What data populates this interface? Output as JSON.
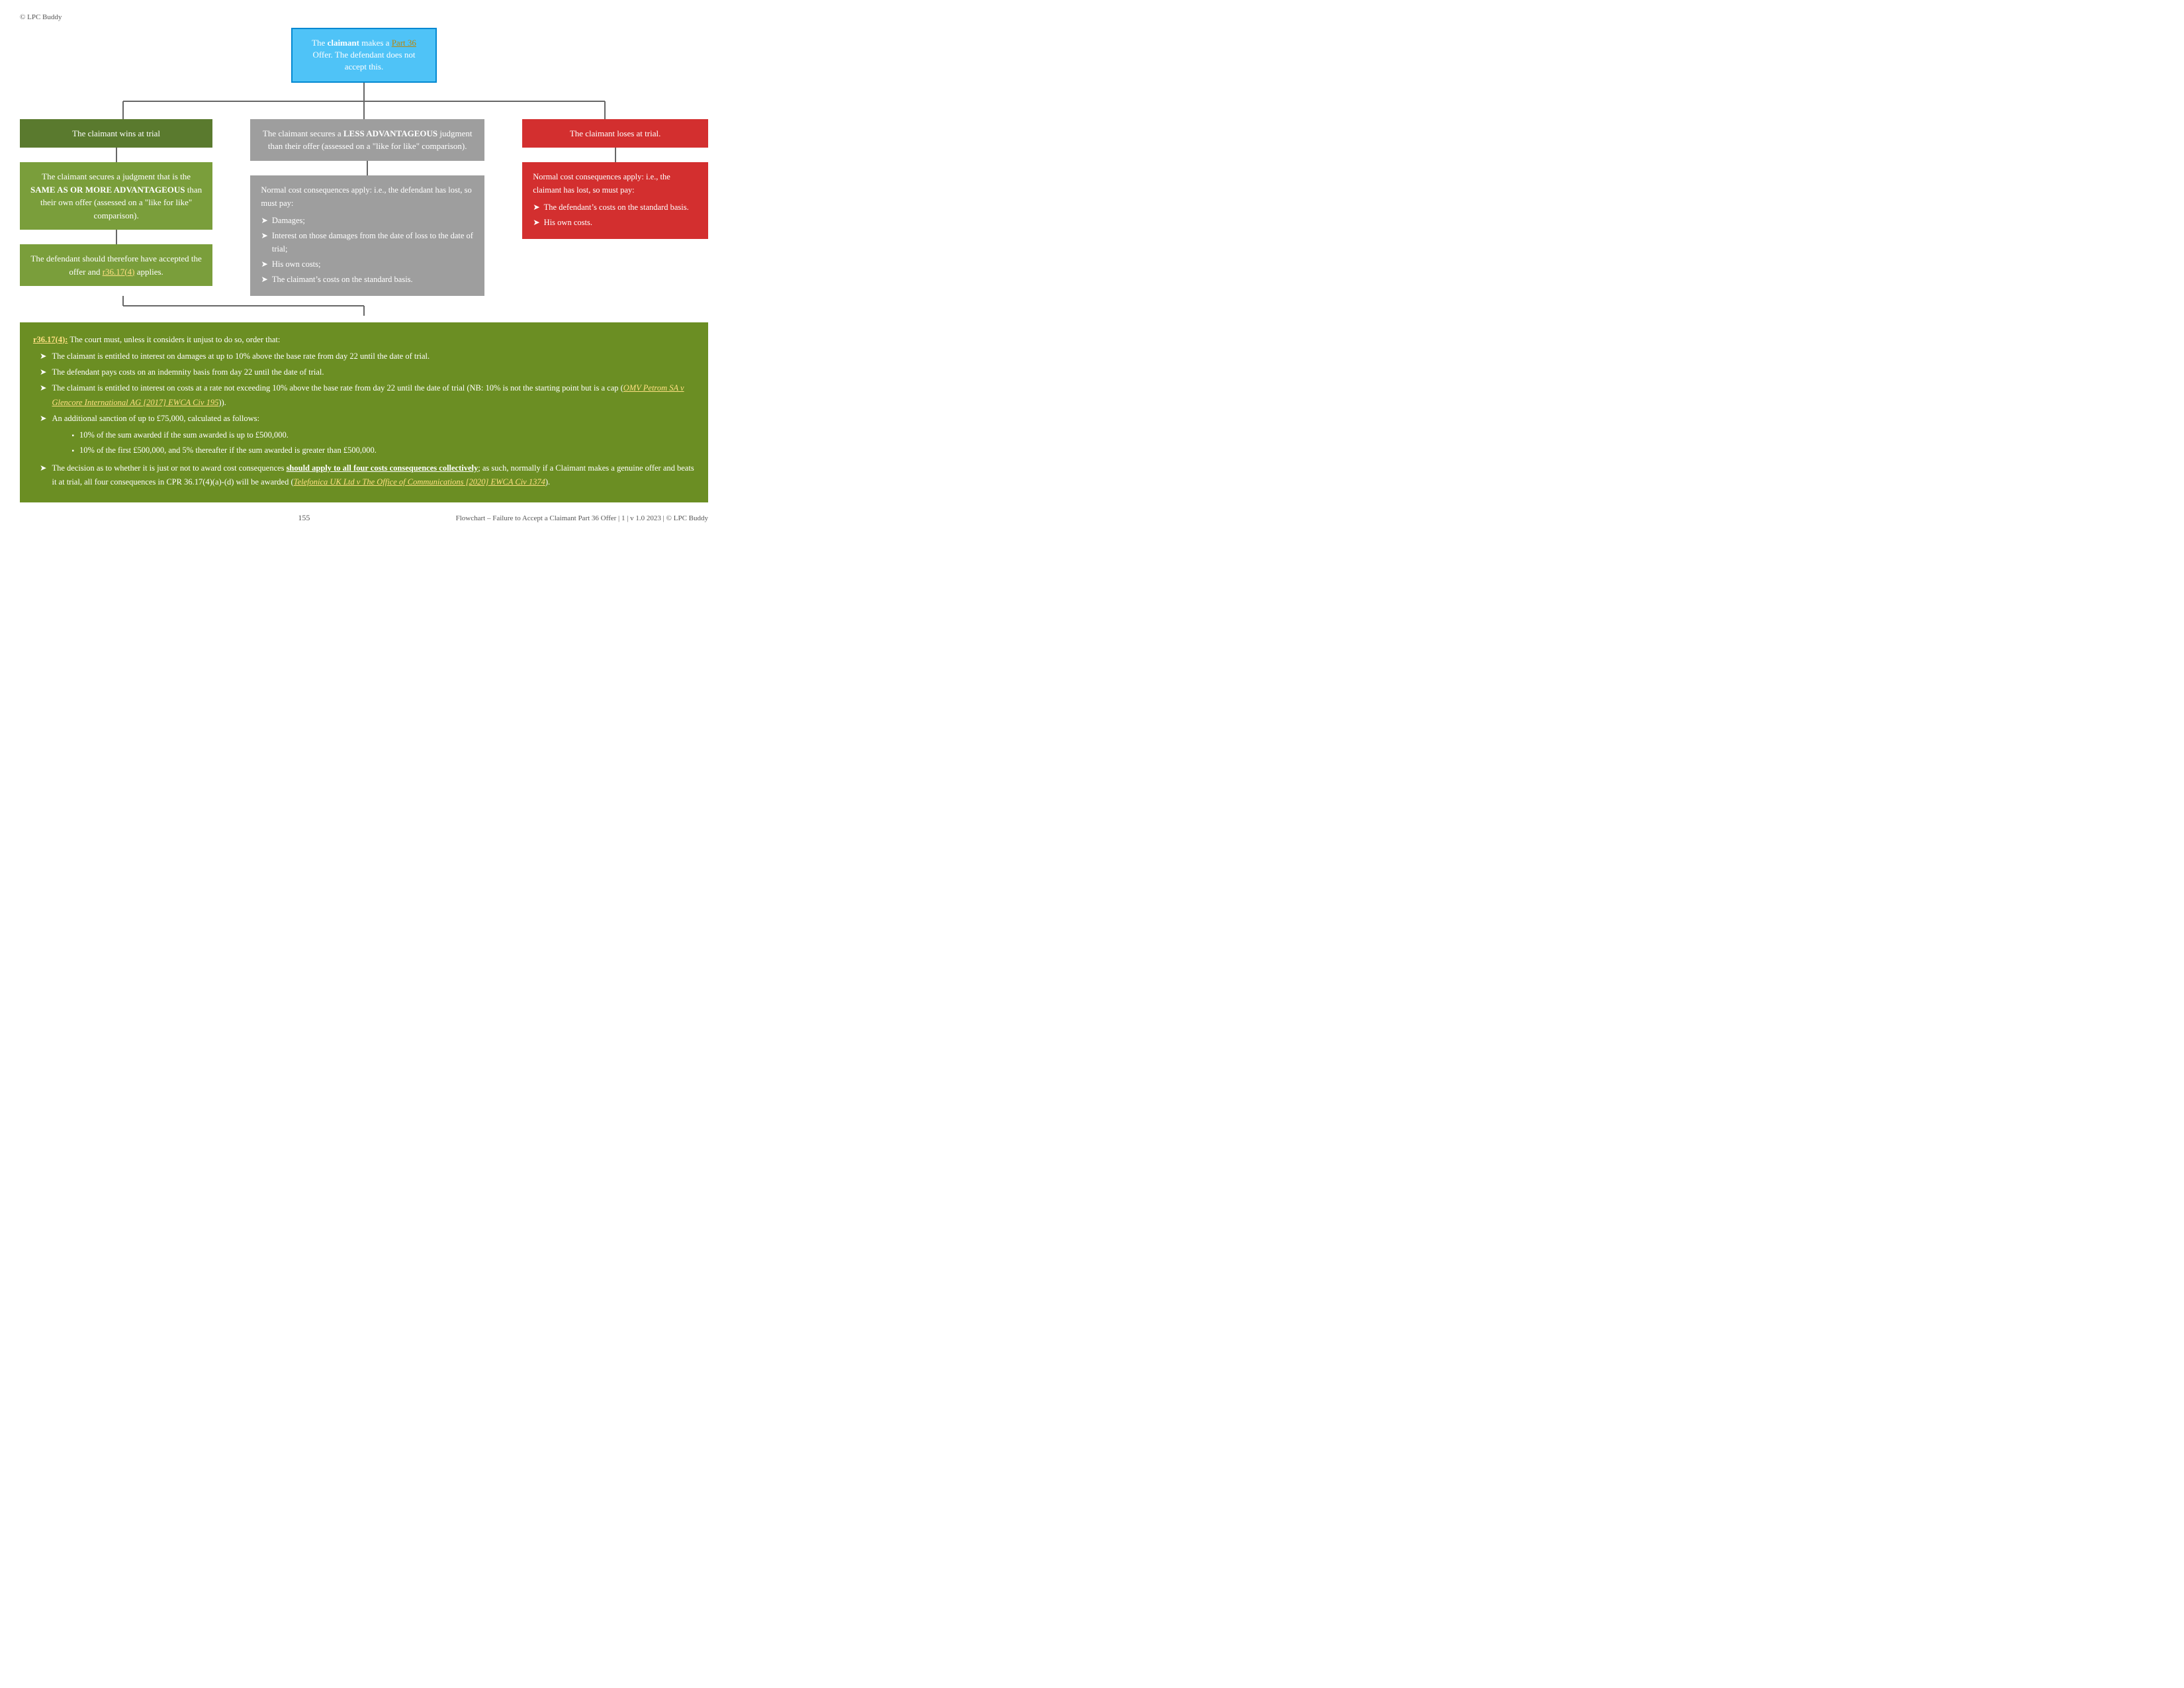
{
  "copyright": "© LPC Buddy",
  "top_box": {
    "text_before": "The ",
    "bold": "claimant",
    "text_after": " makes a ",
    "link_text": "Part 36",
    "text_end": " Offer. The defendant does not accept this."
  },
  "left_col": {
    "title_box": "The claimant wins at trial",
    "judgment_box": "The claimant secures a judgment that is the SAME AS OR MORE ADVANTAGEOUS than their own offer (assessed on a “like for like” comparison).",
    "defendant_box": {
      "text_before": "The defendant should therefore have accepted the offer and ",
      "link": "r36.17(4)",
      "text_after": " applies."
    }
  },
  "mid_col": {
    "less_adv_box": "The claimant secures a LESS ADVANTAGEOUS judgment than their offer (assessed on a “like for like” comparison).",
    "normal_cost_header": "Normal cost consequences apply: i.e., the defendant has lost, so must pay:",
    "normal_cost_items": [
      "Damages;",
      "Interest on those damages from the date of loss to the date of trial;",
      "His own costs;",
      "The claimant’s costs on the standard basis."
    ]
  },
  "right_col": {
    "title_box": "The claimant loses at trial.",
    "normal_cost_header": "Normal cost consequences apply: i.e., the claimant has lost, so must pay:",
    "normal_cost_items": [
      "The defendant’s costs on the standard basis.",
      "His own costs."
    ]
  },
  "bottom_section": {
    "ref_link": "r36.17(4):",
    "intro": " The court must, unless it considers it unjust to do so, order that:",
    "items": [
      "The claimant is entitled to interest on damages at up to 10% above the base rate from day 22 until the date of trial.",
      "The defendant pays costs on an indemnity basis from day 22 until the date of trial.",
      {
        "text_before": "The claimant is entitled to interest on costs at a rate not exceeding 10% above the base rate from day 22 until the date of trial (NB: 10% is not the starting point but is a cap (",
        "link_text": "OMV Petrom SA v Glencore International AG [2017] EWCA Civ 195",
        "text_after": "))."
      },
      {
        "text_before": "An additional sanction of up to £75,000, calculated as follows:",
        "sub_items": [
          "10% of the sum awarded if the sum awarded is up to £500,000.",
          "10% of the first £500,000, and 5% thereafter if the sum awarded is greater than £500,000."
        ]
      },
      {
        "text_before": "The decision as to whether it is just or not to award cost consequences ",
        "bold": "should apply to all four costs consequences collectively",
        "text_after": "; as such, normally if a Claimant makes a genuine offer and beats it at trial, all four consequences in CPR 36.17(4)(a)-(d) will be awarded (",
        "link_text": "Telefonica UK Ltd v The Office of Communications [2020] EWCA Civ 1374",
        "text_after2": ")."
      }
    ]
  },
  "footer": {
    "right_text": "Flowchart – Failure to Accept a Claimant Part 36 Offer | 1 | v 1.0 2023 | © LPC Buddy",
    "page_number": "155"
  }
}
